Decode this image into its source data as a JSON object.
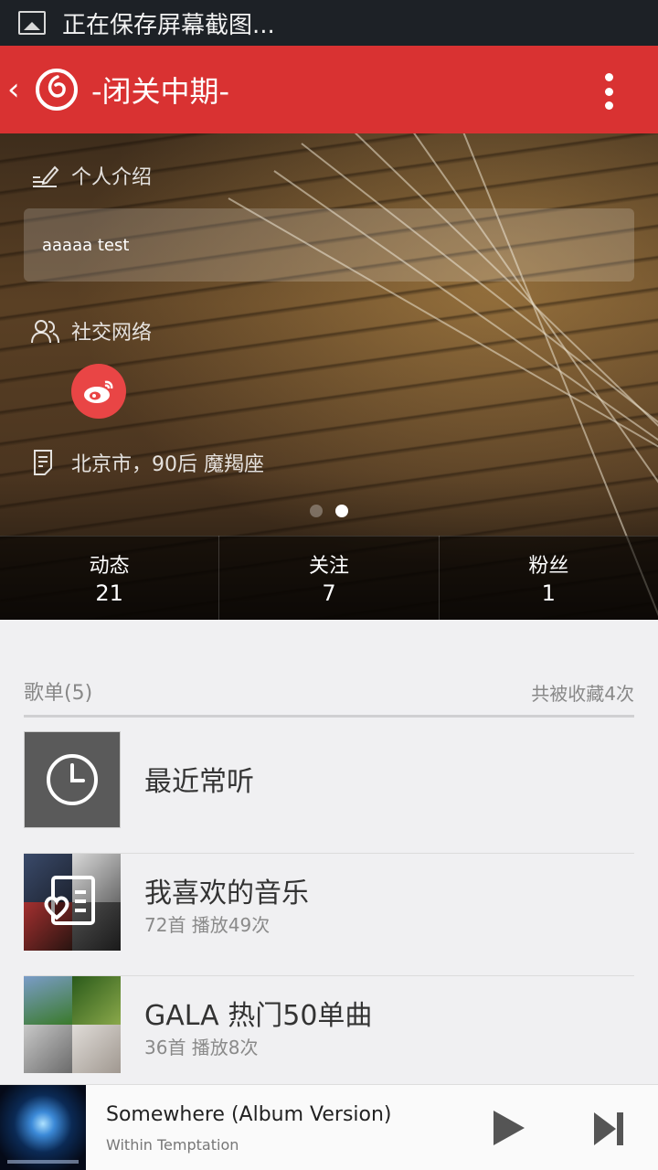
{
  "status_bar": {
    "text": "正在保存屏幕截图..."
  },
  "header": {
    "back": "‹",
    "title": "-闭关中期-"
  },
  "profile": {
    "intro_label": "个人介绍",
    "intro_text": "aaaaa test",
    "social_label": "社交网络",
    "location": "北京市，90后 魔羯座",
    "page_indicator": {
      "count": 2,
      "active": 2
    }
  },
  "stats": [
    {
      "label": "动态",
      "value": "21"
    },
    {
      "label": "关注",
      "value": "7"
    },
    {
      "label": "粉丝",
      "value": "1"
    }
  ],
  "playlists": {
    "header": "歌单(5)",
    "collected": "共被收藏4次",
    "items": [
      {
        "name": "最近常听",
        "meta": ""
      },
      {
        "name": "我喜欢的音乐",
        "meta": "72首 播放49次"
      },
      {
        "name": "GALA 热门50单曲",
        "meta": "36首 播放8次"
      }
    ]
  },
  "player": {
    "song": "Somewhere (Album Version)",
    "artist": "Within Temptation"
  },
  "colors": {
    "brand_red": "#d93232",
    "weibo_red": "#e94545"
  }
}
